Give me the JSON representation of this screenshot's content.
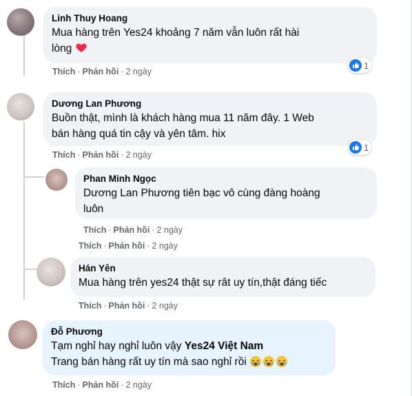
{
  "comments": [
    {
      "author": "Linh Thuy Hoang",
      "line1": "Mua hàng trên Yes24 khoảng 7 năm vẫn luôn rất hài",
      "line2": "lòng",
      "actions": {
        "like": "Thích",
        "reply": "Phản hồi",
        "time": "2 ngày"
      },
      "reaction_count": "1"
    },
    {
      "author": "Dương Lan Phương",
      "line1": "Buồn thật, mình là khách hàng mua 11 năm đây. 1 Web",
      "line2": "bán hàng quá tin cậy và yên tâm. hix",
      "actions": {
        "like": "Thích",
        "reply": "Phản hồi",
        "time": "2 ngày"
      },
      "reaction_count": "1"
    },
    {
      "author": "Phan Minh Ngọc",
      "line1": "Dương Lan Phương tiên bạc vô cùng đàng hoàng",
      "line2": "luôn",
      "actions": {
        "like": "Thích",
        "reply": "Phản hồi",
        "time": "2 ngày"
      }
    },
    {
      "actions_only": {
        "like": "Thích",
        "reply": "Phản hồi",
        "time": "2 ngày"
      }
    },
    {
      "author": "Hán Yên",
      "line1": "Mua hàng trên yes24 thật sự rât uy tín,thật đáng tiếc",
      "actions": {
        "like": "Thích",
        "reply": "Phản hồi",
        "time": "2 ngày"
      }
    },
    {
      "author": "Đỗ Phương",
      "line1_prefix": "Tạm nghỉ hay nghỉ luôn vậy ",
      "line1_mention": "Yes24 Việt Nam",
      "line2": "Trang bán hàng rất uy tín mà sao nghỉ rồi",
      "actions": {
        "like": "Thích",
        "reply": "Phản hồi",
        "time": "2 ngày"
      }
    }
  ],
  "separator": "·",
  "colors": {
    "bubble": "#f0f2f5",
    "highlight": "#e7f3ff",
    "like_blue": "#1877f2",
    "heart_red": "#f02849"
  }
}
